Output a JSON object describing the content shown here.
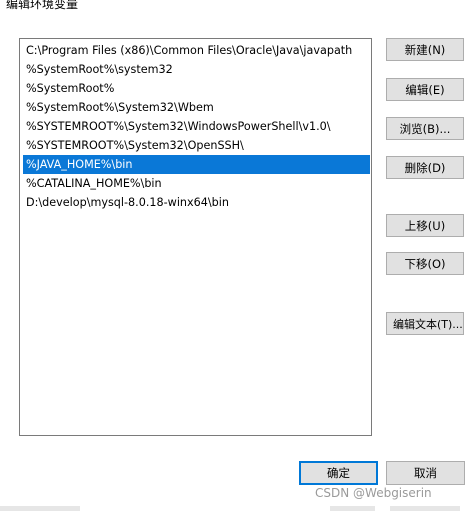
{
  "window": {
    "title": "编辑环境变量"
  },
  "list": {
    "items": [
      {
        "text": "C:\\Program Files (x86)\\Common Files\\Oracle\\Java\\javapath",
        "selected": false
      },
      {
        "text": "%SystemRoot%\\system32",
        "selected": false
      },
      {
        "text": "%SystemRoot%",
        "selected": false
      },
      {
        "text": "%SystemRoot%\\System32\\Wbem",
        "selected": false
      },
      {
        "text": "%SYSTEMROOT%\\System32\\WindowsPowerShell\\v1.0\\",
        "selected": false
      },
      {
        "text": "%SYSTEMROOT%\\System32\\OpenSSH\\",
        "selected": false
      },
      {
        "text": "%JAVA_HOME%\\bin",
        "selected": true
      },
      {
        "text": "%CATALINA_HOME%\\bin",
        "selected": false
      },
      {
        "text": "D:\\develop\\mysql-8.0.18-winx64\\bin",
        "selected": false
      }
    ]
  },
  "buttons": {
    "new": "新建(N)",
    "edit": "编辑(E)",
    "browse": "浏览(B)...",
    "delete": "删除(D)",
    "move_up": "上移(U)",
    "move_down": "下移(O)",
    "edit_text": "编辑文本(T)...",
    "ok": "确定",
    "cancel": "取消"
  },
  "watermark": "CSDN @Webgiserin",
  "colors": {
    "selection": "#0a78d7",
    "button_face": "#e1e1e1",
    "button_border": "#adadad",
    "default_button_border": "#0078d7"
  }
}
